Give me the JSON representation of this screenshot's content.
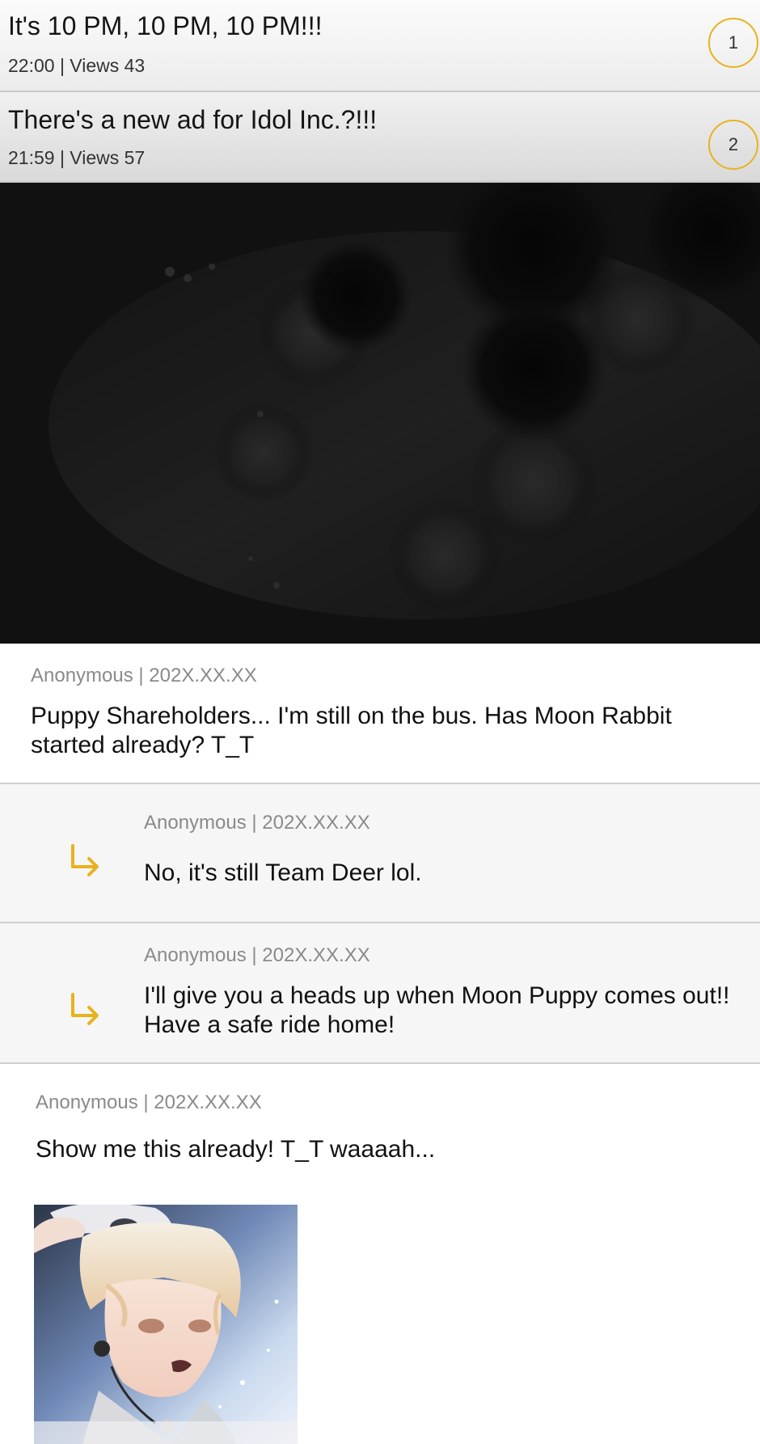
{
  "posts": [
    {
      "title": "It's 10 PM, 10 PM, 10 PM!!!",
      "meta": "22:00 | Views 43",
      "rank": "1"
    },
    {
      "title": "There's a new ad for Idol Inc.?!!!",
      "meta": "21:59 | Views 57",
      "rank": "2"
    }
  ],
  "comments": [
    {
      "meta": "Anonymous | 202X.XX.XX",
      "text": "Puppy Shareholders... I'm still on the bus. Has Moon Rabbit started already? T_T"
    },
    {
      "meta": "Anonymous | 202X.XX.XX",
      "text": "No, it's still Team Deer lol."
    },
    {
      "meta": "Anonymous | 202X.XX.XX",
      "text": "I'll give you a heads up when Moon Puppy comes out!! Have a safe ride home!"
    },
    {
      "meta": "Anonymous | 202X.XX.XX",
      "text": "Show me this already! T_T waaaah..."
    }
  ],
  "icons": {
    "reply": "reply-arrow-icon"
  },
  "colors": {
    "accent": "#e8b21e",
    "panel_bg": "#0f0f0f"
  }
}
